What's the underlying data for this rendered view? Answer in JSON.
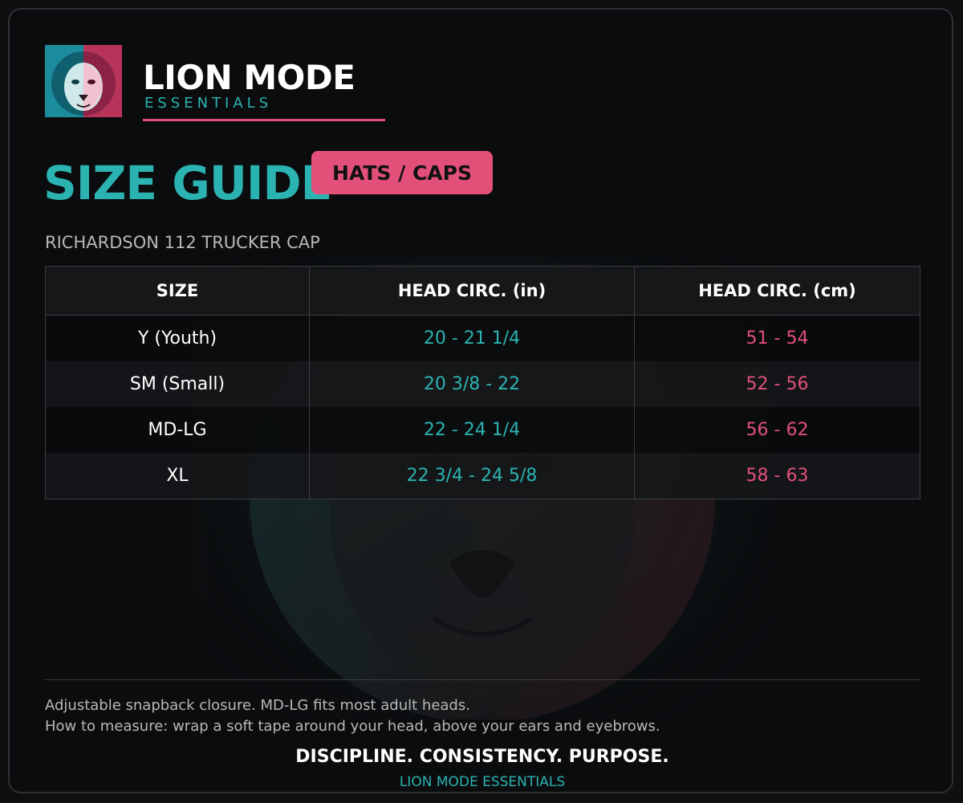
{
  "brand": {
    "title": "LION MODE",
    "subtitle": "ESSENTIALS",
    "logo_icon": "lion-head-icon"
  },
  "heading": {
    "title": "SIZE GUIDE",
    "category": "HATS / CAPS"
  },
  "product": "RICHARDSON 112 TRUCKER CAP",
  "table": {
    "headers": [
      "SIZE",
      "HEAD CIRC. (in)",
      "HEAD CIRC. (cm)"
    ],
    "rows": [
      {
        "size": "Y (Youth)",
        "inches": "20 - 21 1/4",
        "cm": "51 - 54"
      },
      {
        "size": "SM (Small)",
        "inches": "20 3/8 - 22",
        "cm": "52 - 56"
      },
      {
        "size": "MD-LG",
        "inches": "22 - 24 1/4",
        "cm": "56 - 62"
      },
      {
        "size": "XL",
        "inches": "22 3/4 - 24 5/8",
        "cm": "58 - 63"
      }
    ]
  },
  "notes": {
    "line1": "Adjustable snapback closure. MD-LG fits most adult heads.",
    "line2": "How to measure: wrap a soft tape around your head, above your ears and eyebrows."
  },
  "footer": {
    "tagline": "DISCIPLINE. CONSISTENCY. PURPOSE.",
    "brand": "LION MODE ESSENTIALS"
  },
  "colors": {
    "accent_teal": "#2bb3b1",
    "accent_pink": "#e2507a",
    "background": "#0b0c0e"
  }
}
